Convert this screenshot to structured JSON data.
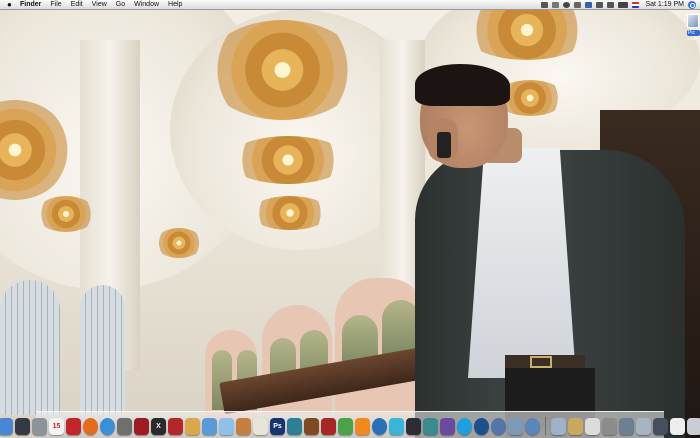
{
  "menubar": {
    "app_name": "Finder",
    "items": [
      "File",
      "Edit",
      "View",
      "Go",
      "Window",
      "Help"
    ],
    "clock": "Sat 1:19 PM"
  },
  "desktop_icon": {
    "label": "Pic",
    "sub": "2.4M"
  },
  "dock": {
    "items": [
      {
        "name": "finder-icon",
        "color": "#4a86d8",
        "glyph": ""
      },
      {
        "name": "dashboard-icon",
        "color": "#333a44",
        "glyph": ""
      },
      {
        "name": "system-preferences-icon",
        "color": "#8d939b",
        "glyph": ""
      },
      {
        "name": "ical-icon",
        "color": "#f4f4f4",
        "glyph": "15"
      },
      {
        "name": "red-app-icon",
        "color": "#c0262c",
        "glyph": ""
      },
      {
        "name": "firefox-icon",
        "color": "#e56b1f",
        "glyph": ""
      },
      {
        "name": "safari-icon",
        "color": "#3a8fd8",
        "glyph": ""
      },
      {
        "name": "gray-app-icon",
        "color": "#6f6f6f",
        "glyph": ""
      },
      {
        "name": "ruby-app-icon",
        "color": "#9c1c22",
        "glyph": ""
      },
      {
        "name": "x-app-icon",
        "color": "#2a2a2a",
        "glyph": "X"
      },
      {
        "name": "red-cube-icon",
        "color": "#b3262a",
        "glyph": ""
      },
      {
        "name": "preview-icon",
        "color": "#d9a84a",
        "glyph": ""
      },
      {
        "name": "itunes-icon",
        "color": "#5a9ad8",
        "glyph": ""
      },
      {
        "name": "ichat-icon",
        "color": "#8ec0e8",
        "glyph": ""
      },
      {
        "name": "address-book-icon",
        "color": "#c57f43",
        "glyph": ""
      },
      {
        "name": "mail-icon",
        "color": "#e9e4d8",
        "glyph": ""
      },
      {
        "name": "photoshop-icon",
        "color": "#16356f",
        "glyph": "Ps"
      },
      {
        "name": "dreamweaver-icon",
        "color": "#2e7f95",
        "glyph": ""
      },
      {
        "name": "illustrator-icon",
        "color": "#7d4a24",
        "glyph": ""
      },
      {
        "name": "flash-icon",
        "color": "#a72727",
        "glyph": ""
      },
      {
        "name": "green-app-icon",
        "color": "#4aa24a",
        "glyph": ""
      },
      {
        "name": "vlc-icon",
        "color": "#f08a1e",
        "glyph": ""
      },
      {
        "name": "blue-globe-icon",
        "color": "#2a6fb8",
        "glyph": ""
      },
      {
        "name": "cyan-app-icon",
        "color": "#3ab4d8",
        "glyph": ""
      },
      {
        "name": "dark-app-icon",
        "color": "#2c2c34",
        "glyph": ""
      },
      {
        "name": "teal-app-icon",
        "color": "#3b8a8f",
        "glyph": ""
      },
      {
        "name": "purple-app-icon",
        "color": "#6a4a9c",
        "glyph": ""
      },
      {
        "name": "skype-icon",
        "color": "#1ea0df",
        "glyph": ""
      },
      {
        "name": "quicktime-icon",
        "color": "#1d4f8c",
        "glyph": ""
      },
      {
        "name": "network-icon",
        "color": "#5276a8",
        "glyph": ""
      },
      {
        "name": "photo-app-icon",
        "color": "#7c9ab8",
        "glyph": ""
      },
      {
        "name": "globe-app-icon",
        "color": "#5a86b8",
        "glyph": ""
      },
      {
        "name": "separator",
        "color": "",
        "glyph": ""
      },
      {
        "name": "applications-folder-icon",
        "color": "#9fb2c8",
        "glyph": ""
      },
      {
        "name": "documents-folder-icon",
        "color": "#c9a860",
        "glyph": ""
      },
      {
        "name": "pages-stack-icon",
        "color": "#dcdcdc",
        "glyph": ""
      },
      {
        "name": "downloads-icon",
        "color": "#8c8c8c",
        "glyph": ""
      },
      {
        "name": "photo-stack-icon",
        "color": "#6d7f92",
        "glyph": ""
      },
      {
        "name": "screen-icon",
        "color": "#a7b4c2",
        "glyph": ""
      },
      {
        "name": "monitor-icon",
        "color": "#45505c",
        "glyph": ""
      },
      {
        "name": "page-icon",
        "color": "#eeeeee",
        "glyph": ""
      },
      {
        "name": "trash-icon",
        "color": "#c9ced3",
        "glyph": ""
      }
    ]
  }
}
